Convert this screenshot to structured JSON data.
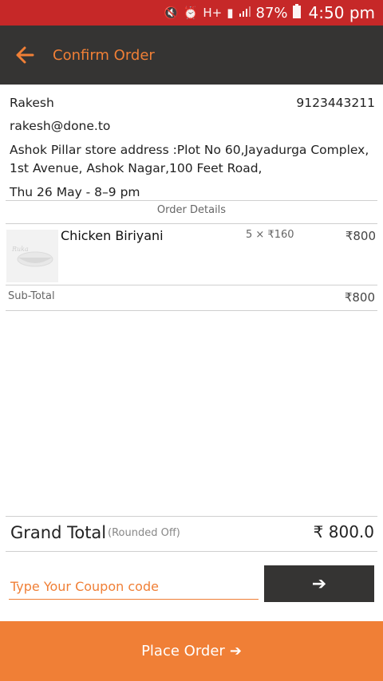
{
  "status_bar": {
    "battery": "87%",
    "time": "4:50 pm"
  },
  "header": {
    "title": "Confirm Order"
  },
  "customer": {
    "name": "Rakesh",
    "phone": "9123443211",
    "email": "rakesh@done.to",
    "address": "Ashok Pillar store address :Plot No 60,Jayadurga Complex, 1st Avenue, Ashok Nagar,100 Feet Road,",
    "delivery_slot": "Thu 26 May - 8–9 pm"
  },
  "order": {
    "section_title": "Order Details",
    "items": [
      {
        "name": "Chicken Biriyani",
        "qty_price": "5 × ₹160",
        "total": "₹800"
      }
    ],
    "subtotal_label": "Sub-Total",
    "subtotal_value": "₹800"
  },
  "grand_total": {
    "label": "Grand Total",
    "note": "(Rounded Off)",
    "value": "₹ 800.0"
  },
  "coupon": {
    "placeholder": "Type Your Coupon code",
    "value": ""
  },
  "actions": {
    "place_order": "Place Order"
  },
  "colors": {
    "accent": "#f07f36",
    "dark": "#353433",
    "status_bar": "#c62828"
  }
}
